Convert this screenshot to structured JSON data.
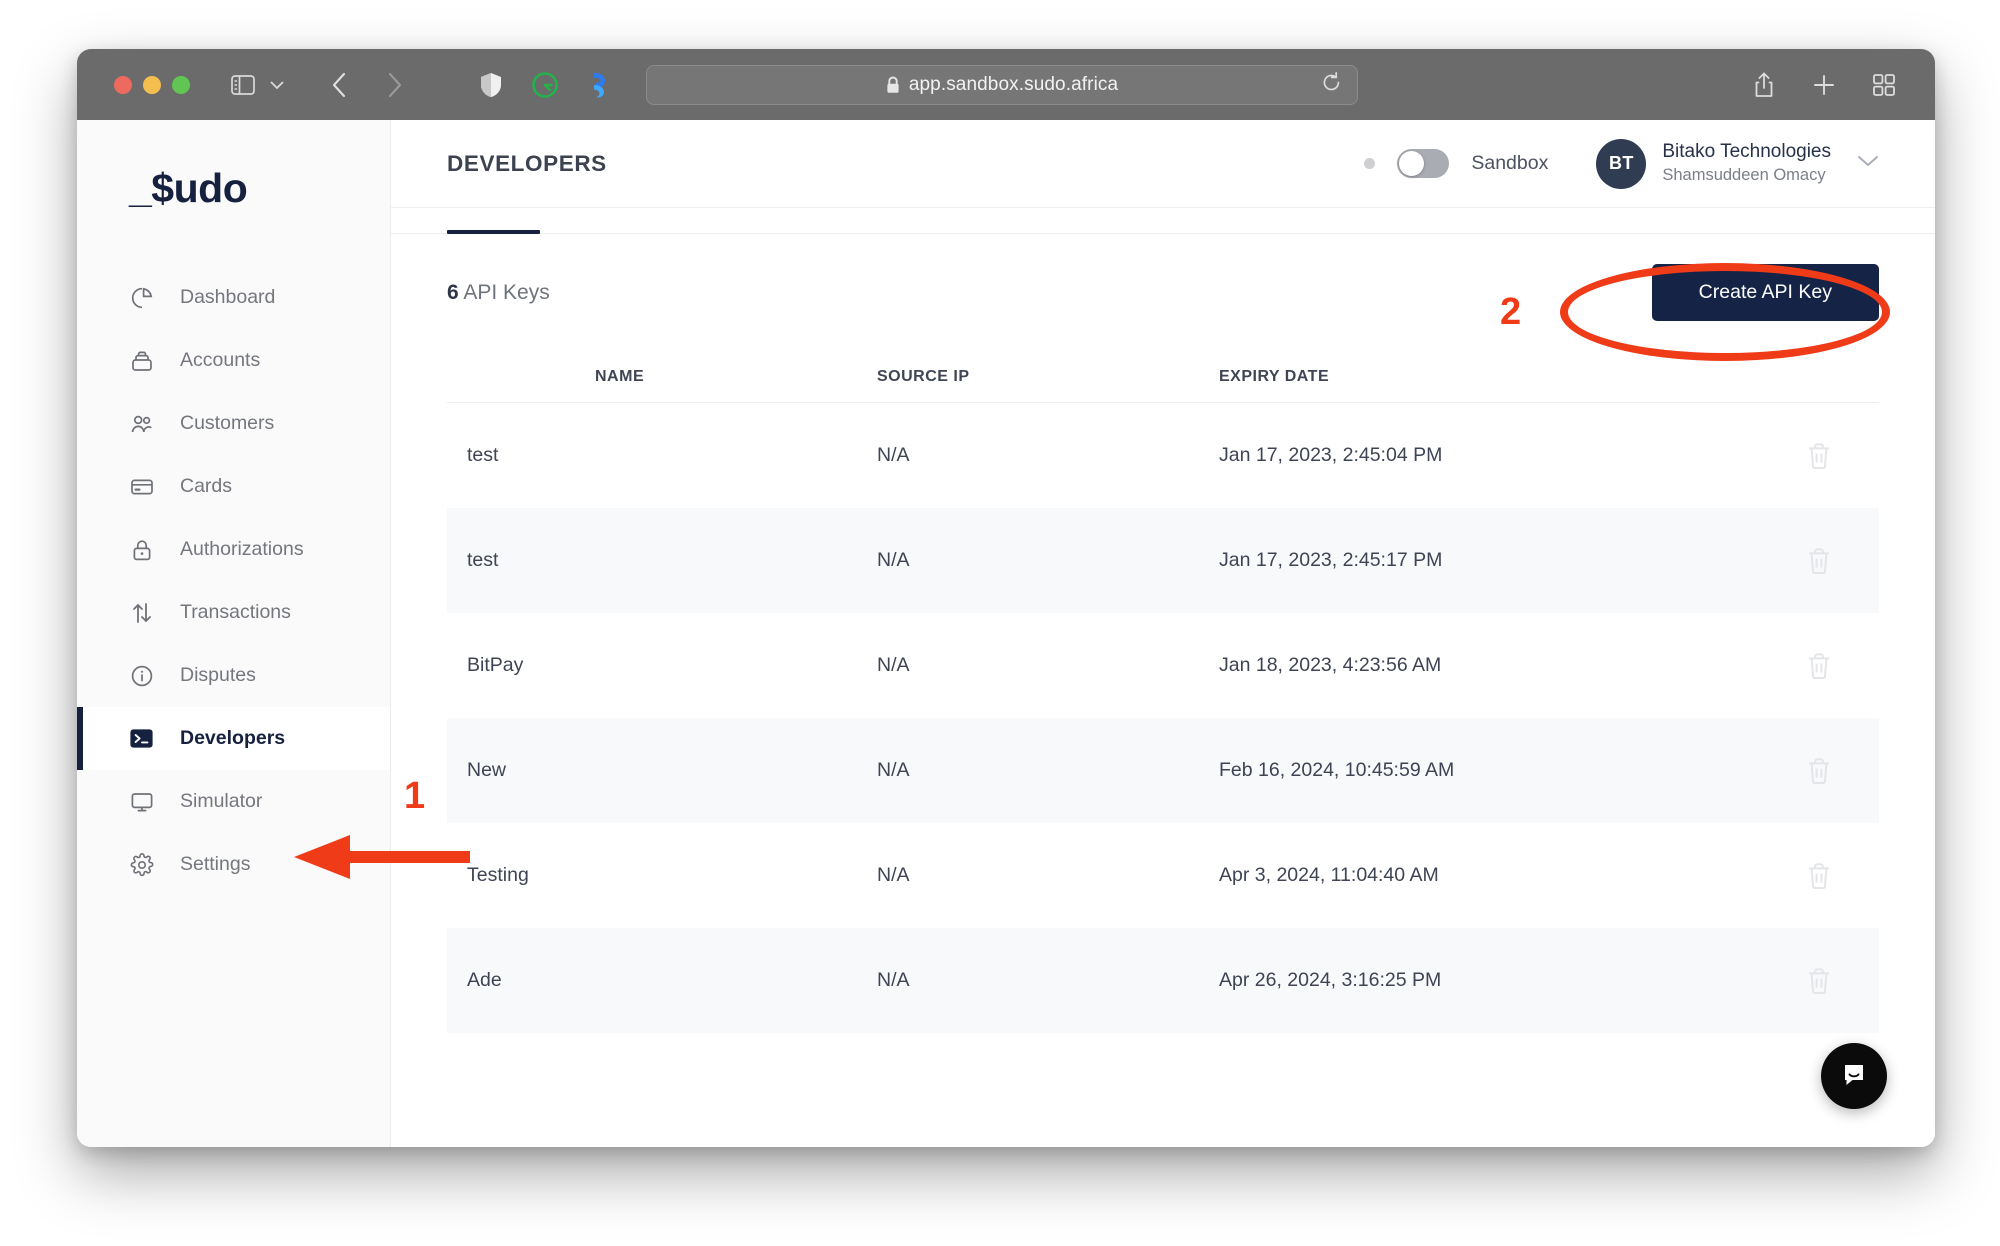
{
  "browser": {
    "url": "app.sandbox.sudo.africa",
    "lock_icon": "lock-icon",
    "reload_icon": "reload-icon",
    "back_icon": "chevron-left-icon",
    "forward_icon": "chevron-right-icon",
    "sidebar_icon": "sidebar-toggle-icon",
    "tab_overview_icon": "tab-overview-icon",
    "share_icon": "share-icon",
    "new_tab_icon": "plus-icon",
    "extensions": [
      "shield-icon",
      "grammarly-icon",
      "copilot-icon"
    ]
  },
  "sidebar": {
    "brand": "_$udo",
    "items": [
      {
        "label": "Dashboard",
        "icon": "pie-chart-icon",
        "active": false
      },
      {
        "label": "Accounts",
        "icon": "bank-icon",
        "active": false
      },
      {
        "label": "Customers",
        "icon": "users-icon",
        "active": false
      },
      {
        "label": "Cards",
        "icon": "credit-card-icon",
        "active": false
      },
      {
        "label": "Authorizations",
        "icon": "lock-icon",
        "active": false
      },
      {
        "label": "Transactions",
        "icon": "arrows-updown-icon",
        "active": false
      },
      {
        "label": "Disputes",
        "icon": "info-circle-icon",
        "active": false
      },
      {
        "label": "Developers",
        "icon": "terminal-icon",
        "active": true
      },
      {
        "label": "Simulator",
        "icon": "monitor-icon",
        "active": false
      },
      {
        "label": "Settings",
        "icon": "gear-icon",
        "active": false
      }
    ]
  },
  "header": {
    "title": "DEVELOPERS",
    "sandbox_label": "Sandbox",
    "sandbox_enabled": false,
    "status_dot_color": "#cfcfd2",
    "avatar_initials": "BT",
    "org_name": "Bitako Technologies",
    "user_name": "Shamsuddeen Omacy",
    "chevron_icon": "chevron-down-icon"
  },
  "content": {
    "count_number": "6",
    "count_label": " API Keys",
    "create_button": "Create API Key",
    "columns": [
      "NAME",
      "SOURCE IP",
      "EXPIRY DATE"
    ],
    "rows": [
      {
        "name": "test",
        "source_ip": "N/A",
        "expiry": "Jan 17, 2023, 2:45:04 PM"
      },
      {
        "name": "test",
        "source_ip": "N/A",
        "expiry": "Jan 17, 2023, 2:45:17 PM"
      },
      {
        "name": "BitPay",
        "source_ip": "N/A",
        "expiry": "Jan 18, 2023, 4:23:56 AM"
      },
      {
        "name": "New",
        "source_ip": "N/A",
        "expiry": "Feb 16, 2024, 10:45:59 AM"
      },
      {
        "name": "Testing",
        "source_ip": "N/A",
        "expiry": "Apr 3, 2024, 11:04:40 AM"
      },
      {
        "name": "Ade",
        "source_ip": "N/A",
        "expiry": "Apr 26, 2024, 3:16:25 PM"
      }
    ],
    "delete_icon": "trash-icon"
  },
  "annotations": {
    "step_one": "1",
    "step_two": "2",
    "color": "#ef3b18",
    "arrow_icon": "arrow-left-icon",
    "ellipse_icon": "ellipse-highlight"
  },
  "chat": {
    "launcher_icon": "chat-bubble-icon"
  },
  "colors": {
    "brand_navy": "#16213f",
    "button_navy": "#152347",
    "annotation_red": "#ef3b18",
    "row_alt": "#f8f9fb",
    "sidebar_bg": "#fafafa"
  }
}
